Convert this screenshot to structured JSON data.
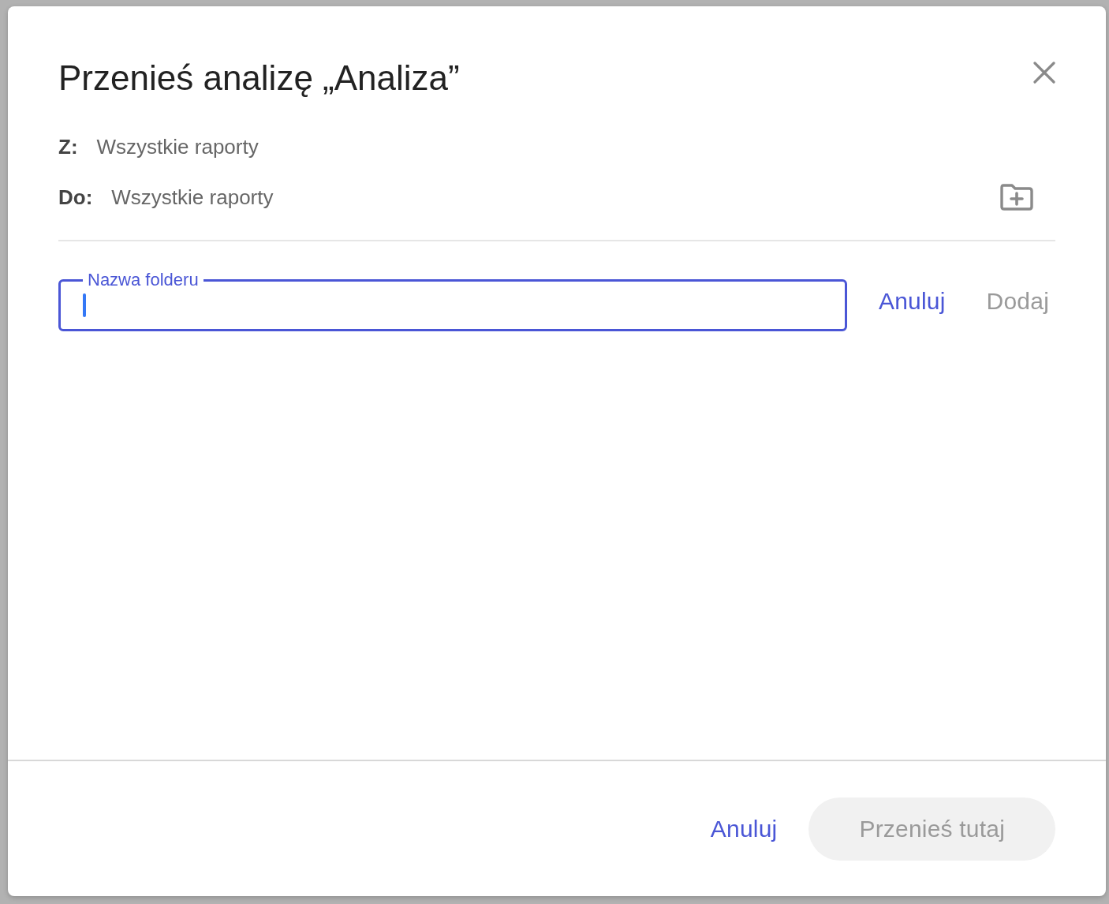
{
  "dialog": {
    "title": "Przenieś analizę „Analiza”",
    "from": {
      "label": "Z:",
      "value": "Wszystkie raporty"
    },
    "to": {
      "label": "Do:",
      "value": "Wszystkie raporty"
    },
    "new_folder_field": {
      "label": "Nazwa folderu",
      "focused": true
    },
    "field_buttons": [
      {
        "label": "Anuluj",
        "disabled": false
      },
      {
        "label": "Dodaj",
        "disabled": true
      }
    ],
    "footer_buttons": [
      {
        "label": "Anuluj",
        "kind": "text",
        "disabled": false
      },
      {
        "label": "Przenieś tutaj",
        "kind": "filled",
        "disabled": true
      }
    ]
  }
}
